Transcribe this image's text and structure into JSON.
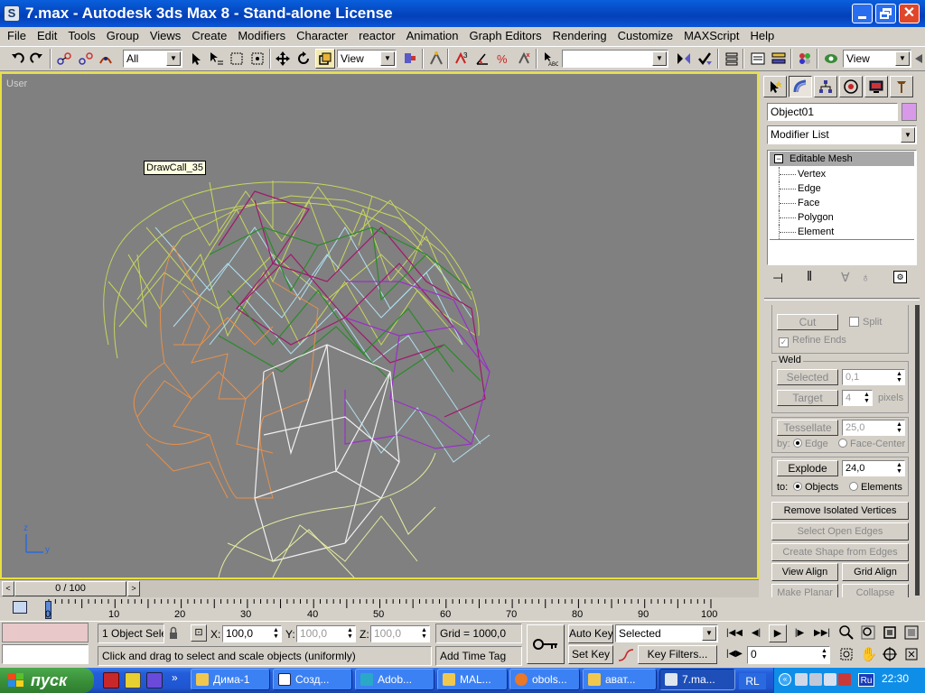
{
  "window": {
    "title": "7.max - Autodesk 3ds Max 8  - Stand-alone License"
  },
  "menu": [
    "File",
    "Edit",
    "Tools",
    "Group",
    "Views",
    "Create",
    "Modifiers",
    "Character",
    "reactor",
    "Animation",
    "Graph Editors",
    "Rendering",
    "Customize",
    "MAXScript",
    "Help"
  ],
  "toolbar": {
    "selection_filter": "All",
    "ref_coord": "View",
    "named_sel": "",
    "view_dropdown": "View"
  },
  "viewport": {
    "label": "User",
    "tooltip": "DrawCall_35",
    "axis_z": "z",
    "axis_y": "y",
    "bg": "#808080"
  },
  "panel": {
    "object_name": "Object01",
    "object_color": "#d89ae8",
    "modifier_list": "Modifier List",
    "stack": {
      "title": "Editable Mesh",
      "items": [
        "Vertex",
        "Edge",
        "Face",
        "Polygon",
        "Element"
      ]
    },
    "rollout": {
      "cut": "Cut",
      "split": "Split",
      "refine_ends": "Refine Ends",
      "weld_group": "Weld",
      "selected_btn": "Selected",
      "selected_val": "0,1",
      "target_btn": "Target",
      "target_val": "4",
      "pixels": "pixels",
      "tessellate_btn": "Tessellate",
      "tessellate_val": "25,0",
      "by": "by:",
      "edge": "Edge",
      "face_center": "Face-Center",
      "explode_btn": "Explode",
      "explode_val": "24,0",
      "to": "to:",
      "objects": "Objects",
      "elements": "Elements",
      "remove_isolated": "Remove Isolated Vertices",
      "select_open_edges": "Select Open Edges",
      "create_shape": "Create Shape from Edges",
      "view_align": "View Align",
      "grid_align": "Grid Align",
      "make_planar": "Make Planar",
      "collapse": "Collapse"
    }
  },
  "timeline": {
    "slider": "0 / 100",
    "ticks": [
      "0",
      "10",
      "20",
      "30",
      "40",
      "50",
      "60",
      "70",
      "80",
      "90",
      "100"
    ]
  },
  "status": {
    "selection": "1 Object Sele",
    "x": "100,0",
    "y": "100,0",
    "z": "100,0",
    "grid": "Grid = 1000,0",
    "prompt": "Click and drag to select and scale objects (uniformly)",
    "add_time_tag": "Add Time Tag",
    "auto_key": "Auto Key",
    "set_key": "Set Key",
    "key_mode": "Selected",
    "key_filters": "Key Filters...",
    "frame": "0"
  },
  "taskbar": {
    "start": "пуск",
    "tasks": [
      "Дима-1",
      "Созд...",
      "Adob...",
      "MAL...",
      "obols...",
      "ават...",
      "7.ma..."
    ],
    "lang": "RL",
    "tray_lang": "Ru",
    "clock": "22:30"
  }
}
